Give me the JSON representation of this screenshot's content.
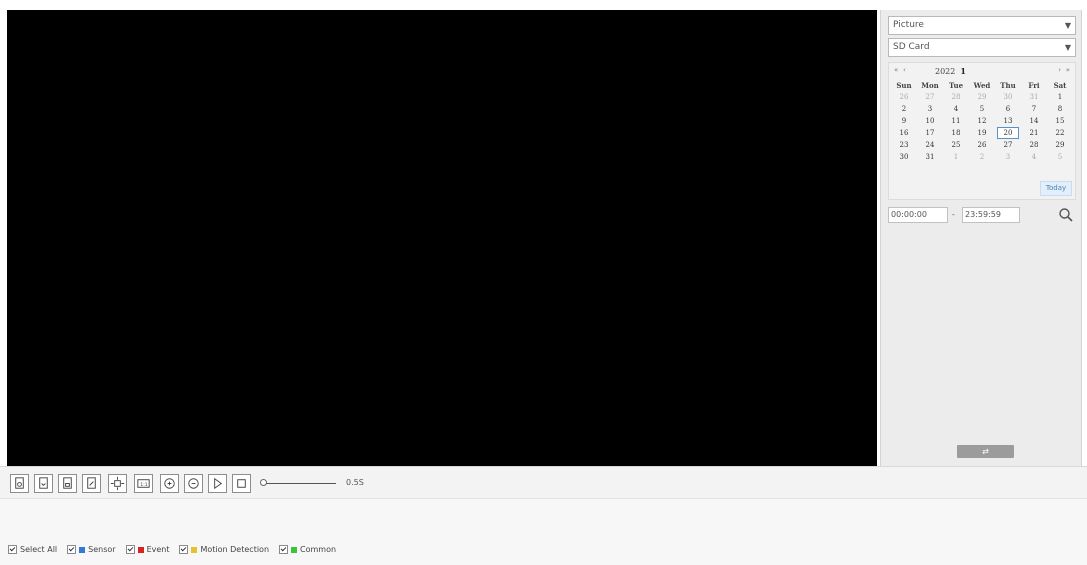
{
  "filters": {
    "type_value": "Picture",
    "source_value": "SD Card"
  },
  "calendar": {
    "nav": {
      "prev_year": "«",
      "prev_month": "‹",
      "next_month": "›",
      "next_year": "»"
    },
    "year": "2022",
    "month": "1",
    "weekdays": [
      "Sun",
      "Mon",
      "Tue",
      "Wed",
      "Thu",
      "Fri",
      "Sat"
    ],
    "weeks": [
      [
        {
          "d": "26",
          "o": true
        },
        {
          "d": "27",
          "o": true
        },
        {
          "d": "28",
          "o": true
        },
        {
          "d": "29",
          "o": true
        },
        {
          "d": "30",
          "o": true
        },
        {
          "d": "31",
          "o": true
        },
        {
          "d": "1"
        }
      ],
      [
        {
          "d": "2"
        },
        {
          "d": "3"
        },
        {
          "d": "4"
        },
        {
          "d": "5"
        },
        {
          "d": "6"
        },
        {
          "d": "7"
        },
        {
          "d": "8"
        }
      ],
      [
        {
          "d": "9"
        },
        {
          "d": "10"
        },
        {
          "d": "11"
        },
        {
          "d": "12"
        },
        {
          "d": "13"
        },
        {
          "d": "14"
        },
        {
          "d": "15"
        }
      ],
      [
        {
          "d": "16"
        },
        {
          "d": "17"
        },
        {
          "d": "18"
        },
        {
          "d": "19"
        },
        {
          "d": "20",
          "sel": true
        },
        {
          "d": "21"
        },
        {
          "d": "22"
        }
      ],
      [
        {
          "d": "23"
        },
        {
          "d": "24"
        },
        {
          "d": "25"
        },
        {
          "d": "26"
        },
        {
          "d": "27"
        },
        {
          "d": "28"
        },
        {
          "d": "29"
        }
      ],
      [
        {
          "d": "30"
        },
        {
          "d": "31"
        },
        {
          "d": "1",
          "o": true
        },
        {
          "d": "2",
          "o": true
        },
        {
          "d": "3",
          "o": true
        },
        {
          "d": "4",
          "o": true
        },
        {
          "d": "5",
          "o": true
        }
      ]
    ],
    "today_label": "Today"
  },
  "time_range": {
    "start": "00:00:00",
    "separator": "-",
    "end": "23:59:59"
  },
  "switch_label": "⇄",
  "toolbar": {
    "buttons": [
      "snapshot-icon",
      "download-icon",
      "save-icon",
      "export-icon",
      "digital-zoom-icon",
      "fit-window-icon",
      "zoom-in-icon",
      "zoom-out-icon",
      "play-icon",
      "stop-icon"
    ],
    "speed_label": "0.5S",
    "speed_fraction": 0.0
  },
  "legend": [
    {
      "label": "Select All",
      "color": null
    },
    {
      "label": "Sensor",
      "color": "#2f7ad6"
    },
    {
      "label": "Event",
      "color": "#d9231f"
    },
    {
      "label": "Motion Detection",
      "color": "#e6c22c"
    },
    {
      "label": "Common",
      "color": "#3cc43c"
    }
  ]
}
